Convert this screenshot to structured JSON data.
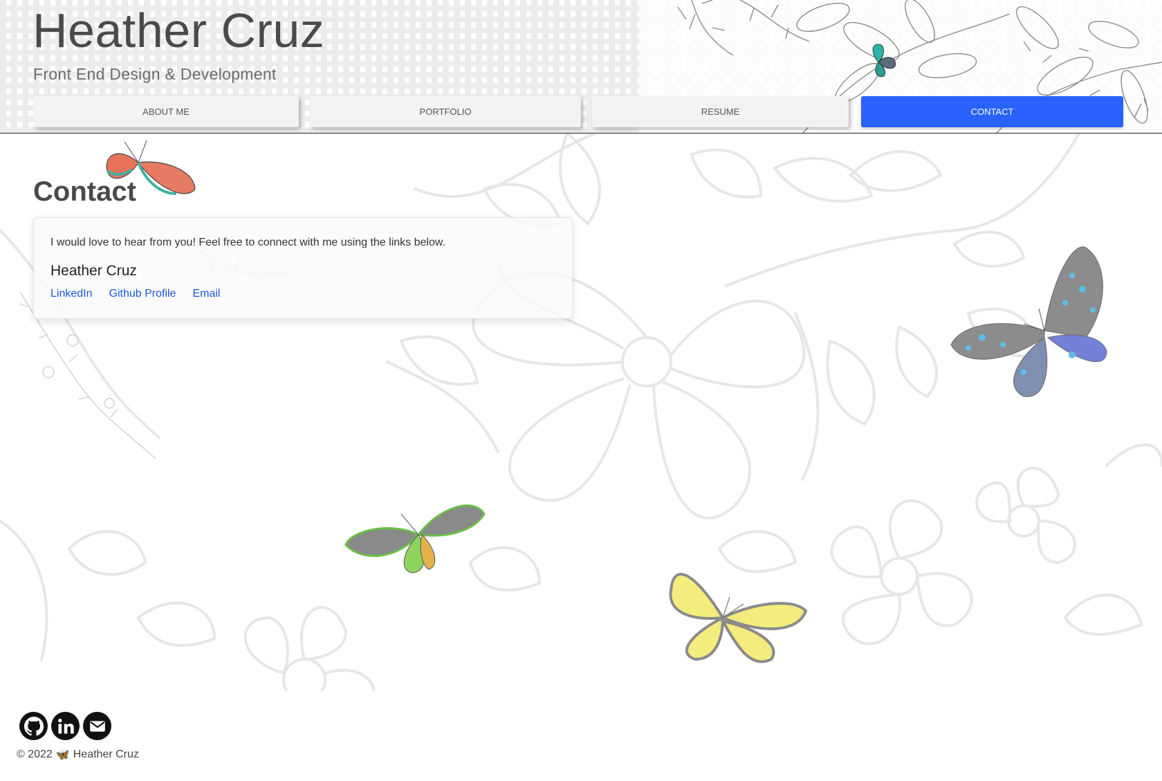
{
  "header": {
    "title": "Heather Cruz",
    "subtitle": "Front End Design & Development"
  },
  "nav": {
    "items": [
      {
        "label": "ABOUT ME",
        "active": false
      },
      {
        "label": "PORTFOLIO",
        "active": false
      },
      {
        "label": "RESUME",
        "active": false
      },
      {
        "label": "CONTACT",
        "active": true
      }
    ]
  },
  "main": {
    "heading": "Contact",
    "card": {
      "text": "I would love to hear from you! Feel free to connect with me using the links below.",
      "name": "Heather Cruz",
      "links": [
        "LinkedIn",
        "Github Profile",
        "Email"
      ]
    }
  },
  "footer": {
    "icons": [
      "github-icon",
      "linkedin-icon",
      "email-icon"
    ],
    "copyright_prefix": "© 2022",
    "copyright_emoji": "🦋",
    "copyright_name": "Heather Cruz"
  },
  "colors": {
    "accent": "#2962ff",
    "link": "#1a56db",
    "tab_bg": "#f2f2f2"
  }
}
